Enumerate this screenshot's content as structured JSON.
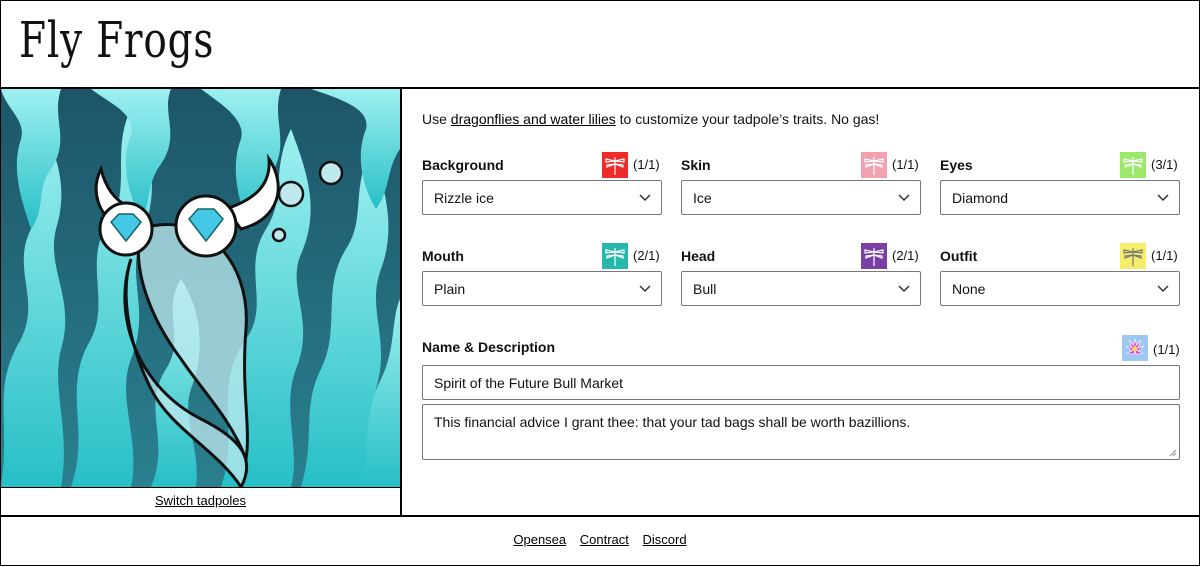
{
  "header": {
    "title": "Fly Frogs"
  },
  "art": {
    "switch_label": "Switch tadpoles",
    "bg_dark": "#1f5d70",
    "bg_light": "#3fc6c9"
  },
  "intro": {
    "before": "Use ",
    "link": "dragonflies and water lilies",
    "after": " to customize your tadpole’s traits. No gas!"
  },
  "traits": [
    {
      "label": "Background",
      "value": "Rizzle ice",
      "count": "(1/1)",
      "color": "#ee2a2a",
      "icon": "dragonfly-icon"
    },
    {
      "label": "Skin",
      "value": "Ice",
      "count": "(1/1)",
      "color": "#f3a1b0",
      "icon": "dragonfly-icon"
    },
    {
      "label": "Eyes",
      "value": "Diamond",
      "count": "(3/1)",
      "color": "#9be86b",
      "icon": "dragonfly-icon"
    },
    {
      "label": "Mouth",
      "value": "Plain",
      "count": "(2/1)",
      "color": "#27b7ad",
      "icon": "dragonfly-icon"
    },
    {
      "label": "Head",
      "value": "Bull",
      "count": "(2/1)",
      "color": "#7a3fa4",
      "icon": "dragonfly-icon"
    },
    {
      "label": "Outfit",
      "value": "None",
      "count": "(1/1)",
      "color": "#f6ee6a",
      "icon": "dragonfly-icon"
    }
  ],
  "name_section": {
    "label": "Name & Description",
    "count": "(1/1)",
    "icon": "water-lily-icon",
    "name": "Spirit of the Future Bull Market",
    "description": "This financial advice I grant thee: that your tad bags shall be worth bazillions."
  },
  "footer": {
    "links": [
      "Opensea",
      "Contract",
      "Discord"
    ]
  }
}
